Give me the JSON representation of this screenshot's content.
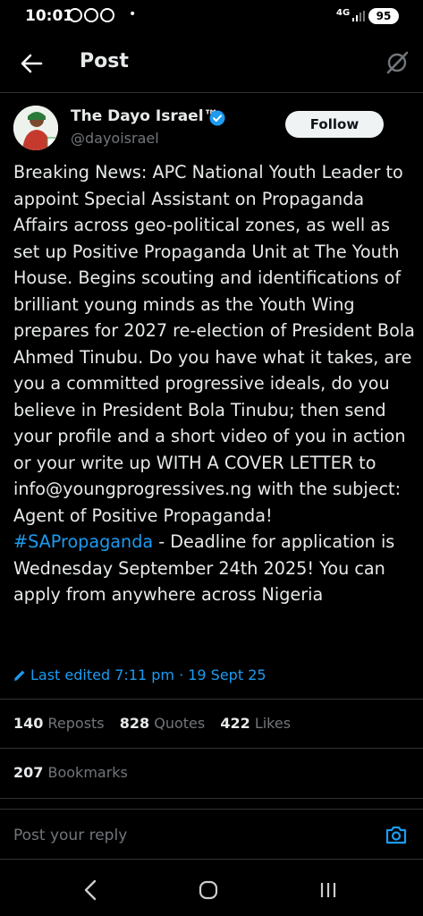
{
  "status_bar": {
    "time": "10:01",
    "network": "4G",
    "battery": "95",
    "icons": [
      "whatsapp-icon",
      "whatsapp-icon",
      "whatsapp-icon",
      "dot-indicator",
      "signal-icon",
      "battery-icon"
    ]
  },
  "header": {
    "title": "Post",
    "icons": [
      "back-arrow-icon",
      "grok-icon"
    ]
  },
  "post": {
    "author_name": "The Dayo Israel™",
    "handle": "@dayoisrael",
    "follow_label": "Follow",
    "text": "Breaking News: APC National Youth Leader to appoint Special Assistant on Propaganda Affairs across geo-political zones, as well as set up Positive Propaganda Unit at The Youth House. Begins scouting and identifications of brilliant young minds as the Youth Wing prepares for 2027 re-election of President Bola Ahmed Tinubu. Do you have what it takes, are you a committed progressive ideals, do you believe in President Bola Tinubu; then send your profile and a short video of you in action or your write up WITH A COVER LETTER to info@youngprogressives.ng with the subject: Agent of Positive Propaganda!",
    "hashtag": "#SAPropaganda",
    "text_after": " - Deadline for application is Wednesday September 24th 2025! You can apply from anywhere across Nigeria",
    "edited": "Last edited 7:11 pm · 19 Sept 25"
  },
  "stats": {
    "reposts_count": "140",
    "reposts_label": "Reposts",
    "quotes_count": "828",
    "quotes_label": "Quotes",
    "likes_count": "422",
    "likes_label": "Likes",
    "bookmarks_count": "207",
    "bookmarks_label": "Bookmarks"
  },
  "reply": {
    "placeholder": "Post your reply"
  },
  "colors": {
    "background": "#000000",
    "text": "#e7e9ea",
    "muted": "#71767b",
    "accent": "#1d9bf0"
  }
}
